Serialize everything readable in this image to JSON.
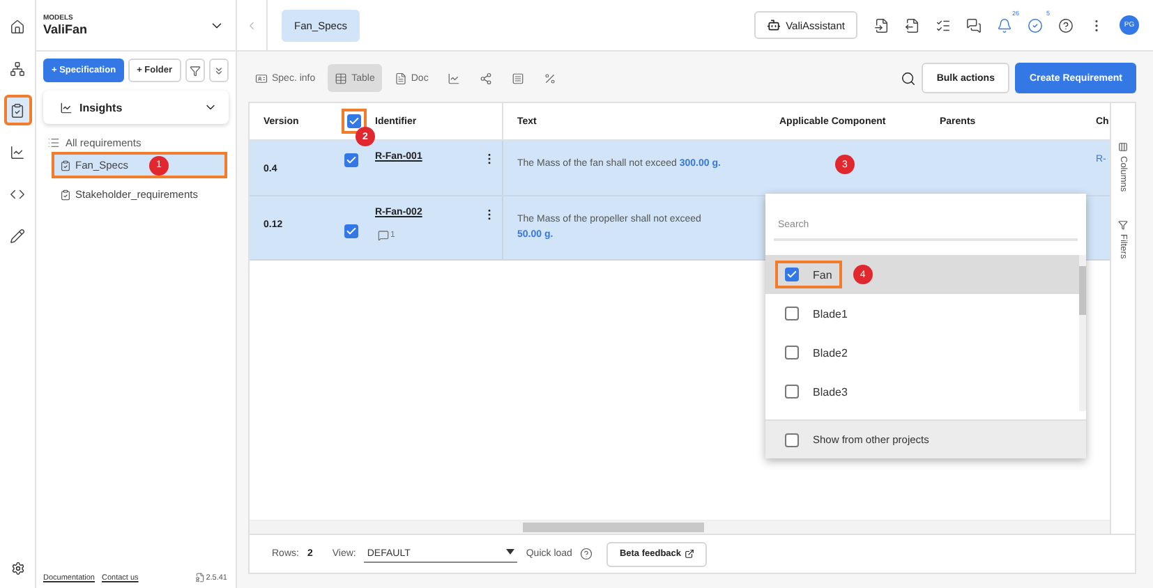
{
  "rail": {
    "items": [
      {
        "kind": "home",
        "selected": false,
        "highlighted": false
      },
      {
        "kind": "network",
        "selected": false,
        "highlighted": false
      },
      {
        "kind": "clipboard",
        "selected": true,
        "highlighted": true
      },
      {
        "kind": "chart",
        "selected": false,
        "highlighted": false
      },
      {
        "kind": "code",
        "selected": false,
        "highlighted": false
      },
      {
        "kind": "pencil",
        "selected": false,
        "highlighted": false
      }
    ]
  },
  "sidebar": {
    "models_label": "MODELS",
    "model": "ValiFan",
    "buttons": [
      {
        "label": "+ Specification",
        "kind": "primary"
      },
      {
        "label": "+ Folder",
        "kind": "outline"
      }
    ],
    "insights": "Insights",
    "all_label": "All requirements",
    "items": [
      {
        "label": "Fan_Specs",
        "selected": true,
        "highlighted": true,
        "badge": "1"
      },
      {
        "label": "Stakeholder_requirements",
        "selected": false,
        "highlighted": false
      }
    ],
    "links": [
      "Documentation",
      "Contact us"
    ],
    "version": "2.5.41"
  },
  "topbar": {
    "tab": "Fan_Specs",
    "assistant": "ValiAssistant",
    "notifications": "26",
    "tasks": "5",
    "avatar": "PG"
  },
  "toolbar": {
    "views": [
      {
        "kind": "info",
        "label": "Spec. info",
        "selected": false
      },
      {
        "kind": "table",
        "label": "Table",
        "selected": true
      },
      {
        "kind": "doc",
        "label": "Doc",
        "selected": false
      },
      {
        "kind": "chart",
        "selected": false
      },
      {
        "kind": "graph",
        "selected": false
      },
      {
        "kind": "list",
        "selected": false
      },
      {
        "kind": "percent",
        "selected": false
      }
    ],
    "bulk": "Bulk actions",
    "create": "Create Requirement"
  },
  "table": {
    "columns": [
      "Version",
      "Identifier",
      "Text",
      "Applicable Component",
      "Parents",
      "Ch"
    ],
    "header_checked": true,
    "header_highlighted": true,
    "header_badge": "2",
    "rows": [
      {
        "version": "0.4",
        "checked": true,
        "identifier": "R-Fan-001",
        "text": "The Mass of the fan shall not exceed ",
        "value": "300.00  g.",
        "component_badge": "3",
        "column_6": "R-",
        "comments": null
      },
      {
        "version": "0.12",
        "checked": true,
        "identifier": "R-Fan-002",
        "text": "The Mass of the propeller shall not exceed ",
        "value": "50.00  g.",
        "comments": "1"
      }
    ],
    "side_tabs": [
      "Columns",
      "Filters"
    ]
  },
  "dropdown": {
    "placeholder": "Search",
    "options": [
      {
        "label": "Fan",
        "checked": true,
        "highlighted": true,
        "badge": "4"
      },
      {
        "label": "Blade1",
        "checked": false,
        "highlighted": false
      },
      {
        "label": "Blade2",
        "checked": false,
        "highlighted": false
      },
      {
        "label": "Blade3",
        "checked": false,
        "highlighted": false
      }
    ],
    "footer": {
      "label": "Show from other projects",
      "checked": false
    }
  },
  "footer": {
    "rows_label": "Rows:",
    "rows": "2",
    "view_label": "View:",
    "view": "DEFAULT",
    "quick_load": "Quick load",
    "feedback": "Beta feedback"
  }
}
